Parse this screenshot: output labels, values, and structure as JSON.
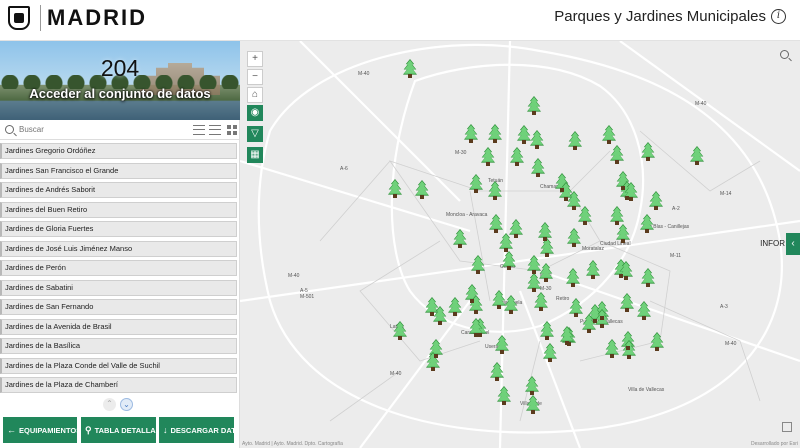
{
  "header": {
    "logo_text": "MADRID",
    "app_title": "Parques y Jardines Municipales",
    "info_symbol": "i"
  },
  "hero": {
    "count": "204",
    "link": "Acceder al conjunto de datos"
  },
  "search": {
    "placeholder": "Buscar"
  },
  "list": {
    "items": [
      "Jardines Gregorio Ordóñez",
      "Jardines San Francisco el Grande",
      "Jardines de Andrés Saborit",
      "Jardines del Buen Retiro",
      "Jardines de Gloria Fuertes",
      "Jardines de José Luis Jiménez Manso",
      "Jardines de Perón",
      "Jardines de Sabatini",
      "Jardines de San Fernando",
      "Jardines de la Avenida de Brasil",
      "Jardines de la Basílica",
      "Jardines de la Plaza Conde del Valle de Suchil",
      "Jardines de la Plaza de Chamberí"
    ]
  },
  "buttons": {
    "equipamientos": "EQUIPAMIENTOS",
    "tabla": "TABLA DETALLADA",
    "descargar": "DESCARGAR DATOS"
  },
  "map": {
    "panel_label": "INFOR",
    "attribution": "Ayto. Madrid | Ayto. Madrid. Dpto. Cartografía",
    "attribution_right": "Desarrollado por Esri",
    "labels": [
      "M-30",
      "M-30",
      "M-40",
      "M-40",
      "M-40",
      "M-40",
      "M-40",
      "M-14",
      "A-2",
      "A-3",
      "A-5",
      "A-6",
      "M-11",
      "M-501",
      "M-30",
      "Tetuán",
      "Chamartín",
      "Moncloa - Aravaca",
      "Centro",
      "Arganzuela",
      "Retiro",
      "Carabanchel",
      "Usera",
      "Latina",
      "Puente de Vallecas",
      "Moratalaz",
      "San Blas - Canillejas",
      "Ciudad Lineal",
      "Villa de Vallecas",
      "Villaverde"
    ]
  },
  "colors": {
    "accent": "#21875b",
    "tree": "#6fd17a"
  }
}
